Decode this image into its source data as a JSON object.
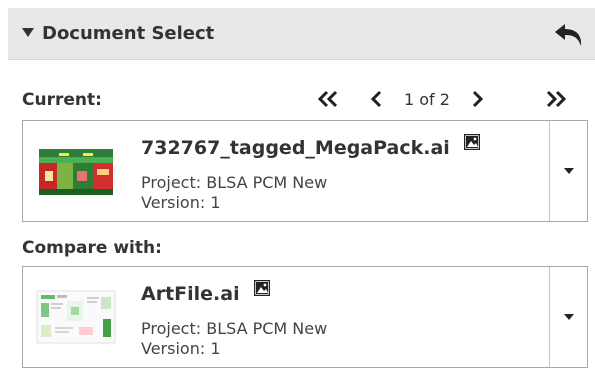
{
  "header": {
    "title": "Document Select",
    "toggle_icon": "triangle-down-icon",
    "back_icon": "undo-arrow-icon"
  },
  "current": {
    "label": "Current:",
    "pager": {
      "text": "1 of 2",
      "first_icon": "double-chevron-left-icon",
      "prev_icon": "chevron-left-icon",
      "next_icon": "chevron-right-icon",
      "last_icon": "double-chevron-right-icon"
    },
    "document": {
      "name": "732767_tagged_MegaPack.ai",
      "project": "Project: BLSA PCM New",
      "version": "Version: 1",
      "thumbnail_icon": "document-thumbnail",
      "type_icon": "image-file-icon",
      "dropdown_icon": "caret-down-icon"
    }
  },
  "compare": {
    "label": "Compare with:",
    "document": {
      "name": "ArtFile.ai",
      "project": "Project: BLSA PCM New",
      "version": "Version: 1",
      "thumbnail_icon": "document-thumbnail",
      "type_icon": "image-file-icon",
      "dropdown_icon": "caret-down-icon"
    }
  },
  "colors": {
    "header_bg": "#e8e8e8",
    "text": "#333333",
    "border": "#a8a8a8"
  }
}
